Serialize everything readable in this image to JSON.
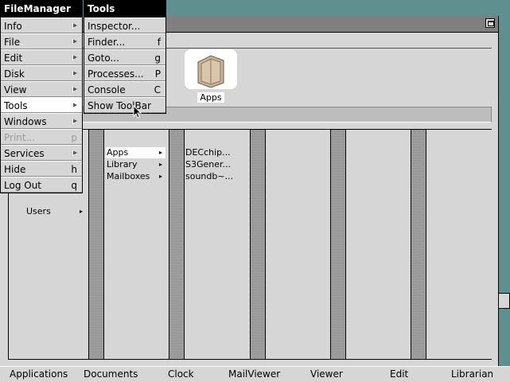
{
  "file_manager_menu": {
    "title": "FileManager",
    "items": [
      {
        "label": "Info",
        "key": "",
        "submenu": true
      },
      {
        "label": "File",
        "key": "",
        "submenu": true
      },
      {
        "label": "Edit",
        "key": "",
        "submenu": true
      },
      {
        "label": "Disk",
        "key": "",
        "submenu": true
      },
      {
        "label": "View",
        "key": "",
        "submenu": true
      },
      {
        "label": "Tools",
        "key": "",
        "submenu": true
      },
      {
        "label": "Windows",
        "key": "",
        "submenu": true
      },
      {
        "label": "Print...",
        "key": "p",
        "submenu": false
      },
      {
        "label": "Services",
        "key": "",
        "submenu": true
      },
      {
        "label": "Hide",
        "key": "h",
        "submenu": false
      },
      {
        "label": "Log Out",
        "key": "q",
        "submenu": false
      }
    ]
  },
  "tools_menu": {
    "title": "Tools",
    "items": [
      {
        "label": "Inspector...",
        "key": ""
      },
      {
        "label": "Finder...",
        "key": "f"
      },
      {
        "label": "Goto...",
        "key": "g"
      },
      {
        "label": "Processes...",
        "key": "P"
      },
      {
        "label": "Console",
        "key": "C"
      },
      {
        "label": "Show ToolBar",
        "key": ""
      }
    ]
  },
  "shelf": {
    "icon_name": "folder-icon",
    "label": "Apps"
  },
  "browser": {
    "col1_partial": "Users",
    "col2": [
      "Apps",
      "Library",
      "Mailboxes"
    ],
    "col3": [
      "DECchip...",
      "S3Gener...",
      "soundb~..."
    ]
  },
  "app_bar": [
    "Applications",
    "Documents",
    "Clock",
    "MailViewer",
    "Viewer",
    "Edit",
    "Librarian"
  ],
  "colors": {
    "desktop": "#5f8f8f",
    "window": "#d6d6d6",
    "titlebar": "#7f7f7f",
    "menu_title": "#000000"
  }
}
